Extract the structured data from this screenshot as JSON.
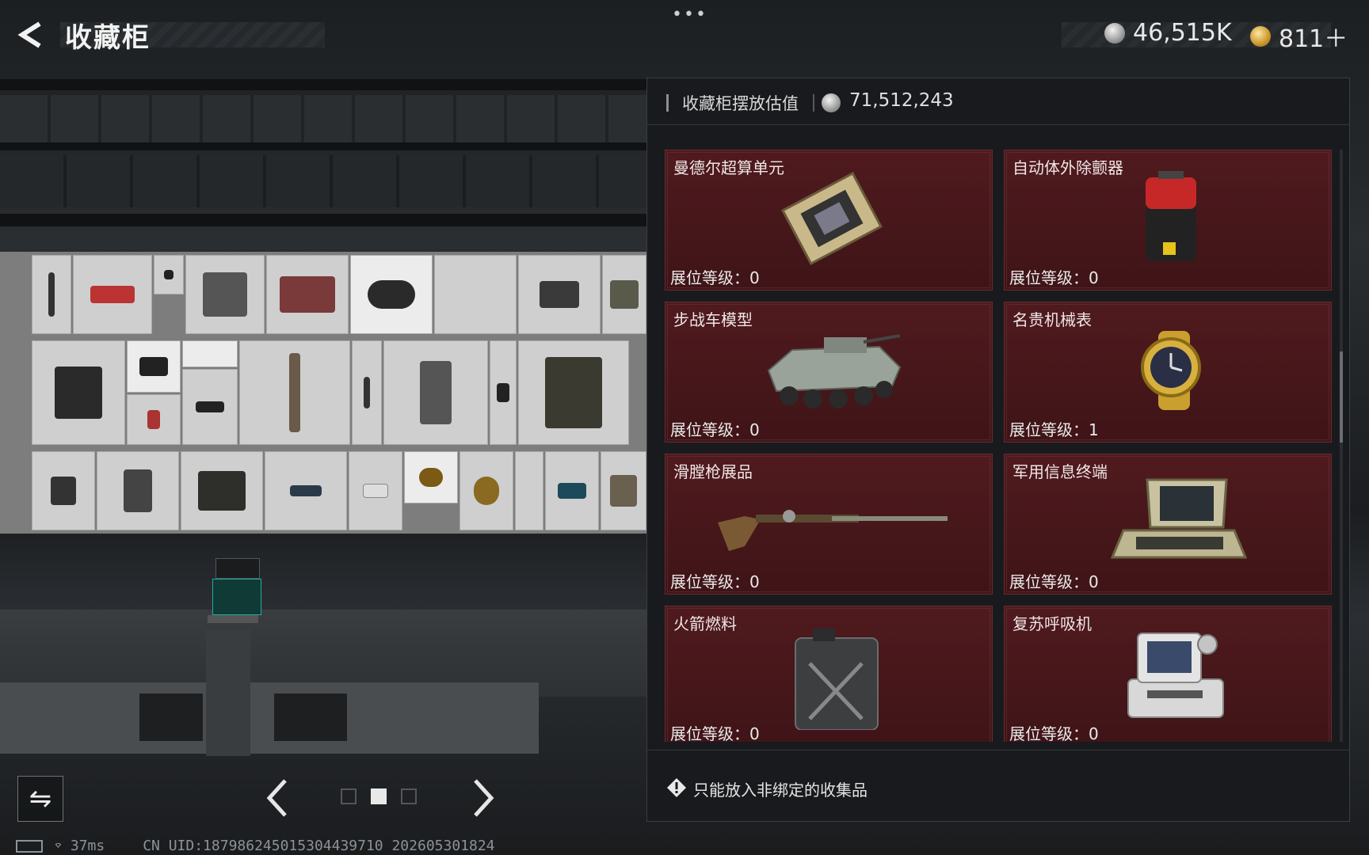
{
  "header": {
    "title": "收藏柜",
    "back_icon": "back-arrow-icon",
    "menu_dots": "•••"
  },
  "currency": {
    "silver_value": "46,515K",
    "gold_value": "811＋"
  },
  "panel": {
    "value_label": "收藏柜摆放估值",
    "value_amount": "71,512,243",
    "items": [
      {
        "name": "曼德尔超算单元",
        "level": "展位等级：0",
        "icon": "computing-unit-icon"
      },
      {
        "name": "自动体外除颤器",
        "level": "展位等级：0",
        "icon": "defibrillator-icon"
      },
      {
        "name": "步战车模型",
        "level": "展位等级：0",
        "icon": "ifv-model-icon"
      },
      {
        "name": "名贵机械表",
        "level": "展位等级：1",
        "icon": "watch-icon"
      },
      {
        "name": "滑膛枪展品",
        "level": "展位等级：0",
        "icon": "musket-icon"
      },
      {
        "name": "军用信息终端",
        "level": "展位等级：0",
        "icon": "military-terminal-icon"
      },
      {
        "name": "火箭燃料",
        "level": "展位等级：0",
        "icon": "fuel-can-icon"
      },
      {
        "name": "复苏呼吸机",
        "level": "展位等级：0",
        "icon": "ventilator-icon"
      }
    ],
    "footer_warning": "只能放入非绑定的收集品"
  },
  "status_bar": {
    "ping": "37ms",
    "uid": "CN UID:18798624501530443971​0 202605301824"
  },
  "colors": {
    "card_bg": "#4a181c",
    "panel_bg": "#181a1d",
    "accent_text": "#e8e8e8"
  }
}
